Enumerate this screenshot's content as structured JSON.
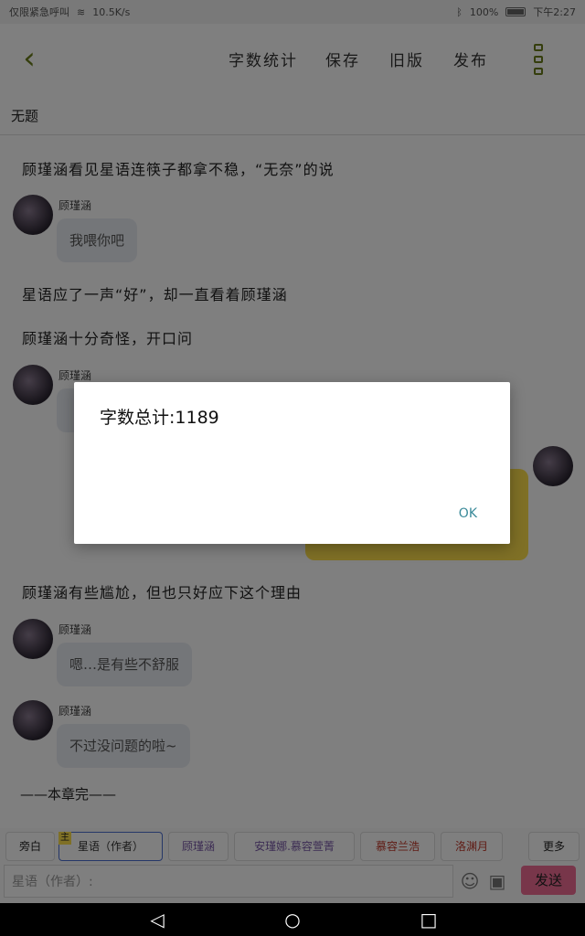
{
  "status": {
    "left_text": "仅限紧急呼叫",
    "speed": "10.5K/s",
    "battery": "100%",
    "time": "下午2:27"
  },
  "toolbar": {
    "back_icon": "chevron-left-icon",
    "word_count_label": "字数统计",
    "save_label": "保存",
    "old_version_label": "旧版",
    "publish_label": "发布",
    "more_icon": "kebab-menu-icon"
  },
  "doc": {
    "title": "无题"
  },
  "content": {
    "p1": "顾瑾涵看见星语连筷子都拿不稳，“无奈”的说",
    "msg1_name": "顾瑾涵",
    "msg1_text": "我喂你吧",
    "p2": "星语应了一声“好”，却一直看着顾瑾涵",
    "p3": "顾瑾涵十分奇怪，开口问",
    "msg2_name": "顾瑾涵",
    "p4": "顾瑾涵有些尴尬，但也只好应下这个理由",
    "msg3_name": "顾瑾涵",
    "msg3_text": "嗯…是有些不舒服",
    "msg4_name": "顾瑾涵",
    "msg4_text": "不过没问题的啦~",
    "end": "——本章完——"
  },
  "roles": {
    "items": [
      "旁白",
      "星语（作者）",
      "顾瑾涵",
      "安瑾娜.慕容萱菁",
      "慕容兰浩",
      "洛渊月"
    ],
    "more_label": "更多",
    "main_badge": "主"
  },
  "input": {
    "placeholder": "星语（作者）:",
    "send_label": "发送"
  },
  "dialog": {
    "message": "字数总计:1189",
    "ok_label": "OK"
  },
  "colors": {
    "accent": "#6a7d1a",
    "send": "#f06c94",
    "bubble_right": "#ffe14d",
    "dialog_ok": "#3a8a99"
  }
}
